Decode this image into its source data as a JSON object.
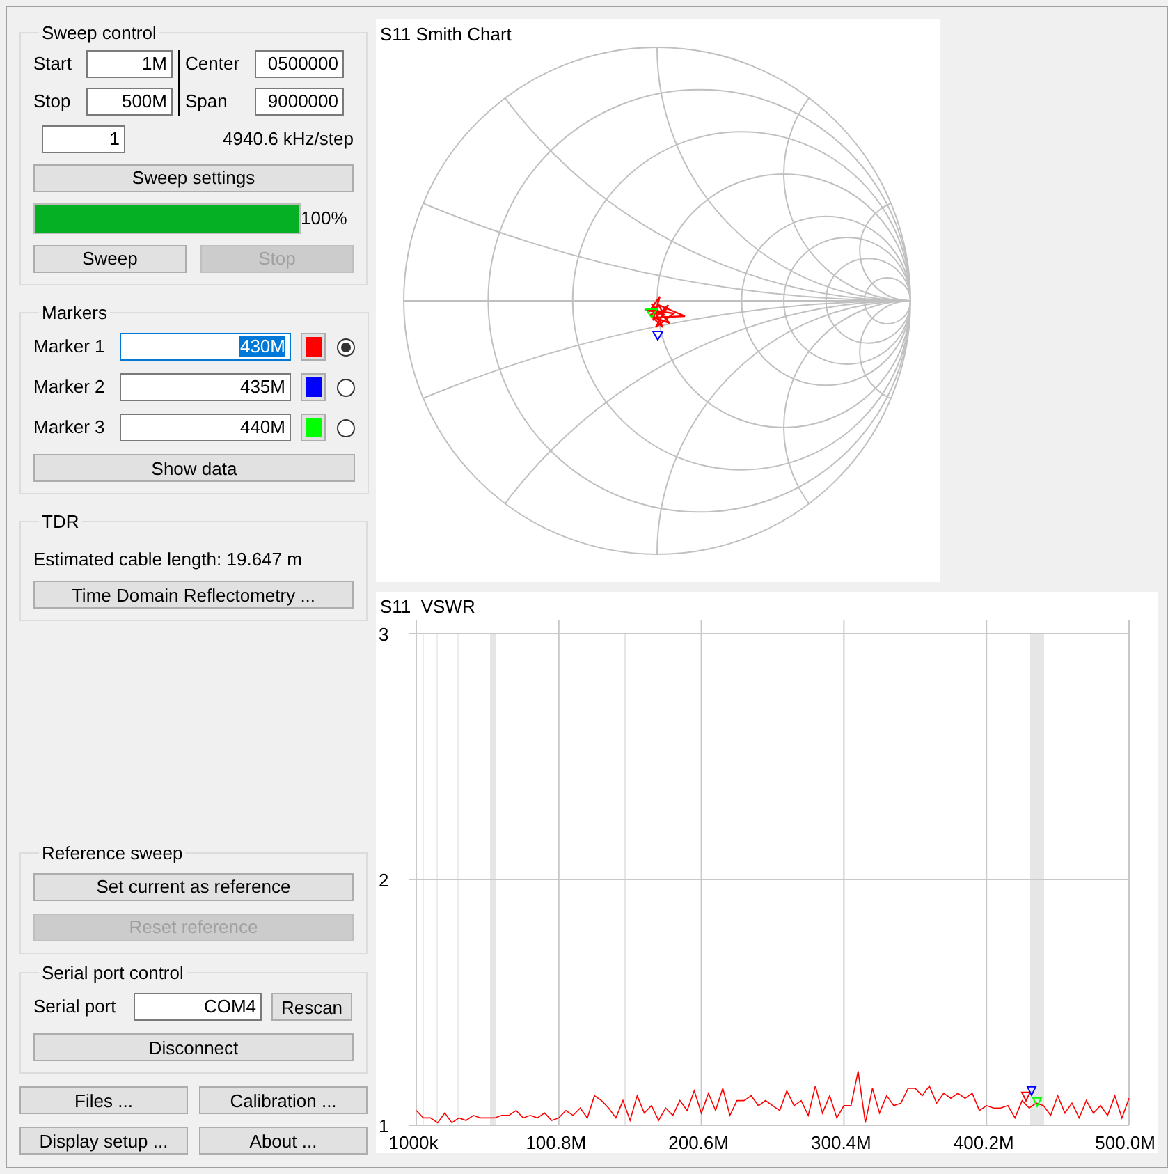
{
  "sweep_control": {
    "title": "Sweep control",
    "start": {
      "label": "Start",
      "value": "1M"
    },
    "stop": {
      "label": "Stop",
      "value": "500M"
    },
    "center": {
      "label": "Center",
      "value": "0500000"
    },
    "span": {
      "label": "Span",
      "value": "9000000"
    },
    "segments": {
      "value": "1"
    },
    "step": "4940.6 kHz/step",
    "settings_button": {
      "label": "Sweep settings",
      "disabled": false
    },
    "progress": {
      "level": 1.0,
      "reading": "100%"
    },
    "sweep_button": {
      "label": "Sweep",
      "disabled": false
    },
    "stop_button": {
      "label": "Stop",
      "disabled": true
    }
  },
  "markers": {
    "title": "Markers",
    "items": [
      {
        "label": "Marker 1",
        "value": "430M",
        "color": "#ff0000",
        "selected": true,
        "focused": true
      },
      {
        "label": "Marker 2",
        "value": "435M",
        "color": "#0000ff",
        "selected": false,
        "focused": false
      },
      {
        "label": "Marker 3",
        "value": "440M",
        "color": "#00ff00",
        "selected": false,
        "focused": false
      }
    ],
    "show_button": {
      "label": "Show data",
      "disabled": false
    }
  },
  "tdr": {
    "title": "TDR",
    "estimate": "Estimated cable length: 19.647 m",
    "button": {
      "label": "Time Domain Reflectometry ...",
      "disabled": false
    }
  },
  "reference_sweep": {
    "title": "Reference sweep",
    "set_button": {
      "label": "Set current as reference",
      "disabled": false
    },
    "reset_button": {
      "label": "Reset reference",
      "disabled": true
    }
  },
  "serial_port": {
    "title": "Serial port control",
    "label": "Serial port",
    "value": "COM4",
    "rescan_button": {
      "label": "Rescan",
      "disabled": false
    },
    "connect_button": {
      "label": "Disconnect",
      "disabled": false
    }
  },
  "bottom_buttons": [
    {
      "label": "Files ...",
      "disabled": false
    },
    {
      "label": "Calibration ...",
      "disabled": false
    },
    {
      "label": "Display setup ...",
      "disabled": false
    },
    {
      "label": "About ...",
      "disabled": false
    }
  ],
  "smith_chart": {
    "title": "S11 Smith Chart"
  },
  "vswr_chart": {
    "title": "S11  VSWR",
    "chart_data": {
      "type": "line",
      "grid": true,
      "xlim": [
        1000000,
        500000000
      ],
      "ylim": [
        1,
        3
      ],
      "x": [
        1000000,
        5990000,
        10980000,
        15970000,
        20960000,
        25950000,
        30940000,
        35930000,
        40920000,
        45910000,
        50900000,
        55890000,
        60880000,
        65870000,
        70860000,
        75850000,
        80840000,
        85830000,
        90820000,
        95810000,
        100800000,
        105790000,
        110780000,
        115770000,
        120760000,
        125750000,
        130740000,
        135730000,
        140720000,
        145710000,
        150700000,
        155690000,
        160680000,
        165670000,
        170660000,
        175650000,
        180640000,
        185630000,
        190620000,
        195610000,
        200600000,
        205590000,
        210580000,
        215570000,
        220560000,
        225550000,
        230540000,
        235530000,
        240520000,
        245510000,
        250500000,
        255490000,
        260480000,
        265470000,
        270460000,
        275450000,
        280440000,
        285430000,
        290420000,
        295410000,
        300400000,
        305390000,
        310380000,
        315370000,
        320360000,
        325350000,
        330340000,
        335330000,
        340320000,
        345310000,
        350300000,
        355290000,
        360280000,
        365270000,
        370260000,
        375250000,
        380240000,
        385230000,
        390220000,
        395210000,
        400200000,
        405190000,
        410180000,
        415170000,
        420160000,
        425150000,
        430140000,
        435130000,
        440120000,
        445110000,
        450100000,
        455090000,
        460080000,
        465070000,
        470060000,
        475050000,
        480040000,
        485030000,
        490020000,
        495010000,
        500000000
      ],
      "xticks": [
        {
          "value": 1000000,
          "label": "1000k"
        },
        {
          "value": 100800000,
          "label": "100.8M"
        },
        {
          "value": 200600000,
          "label": "200.6M"
        },
        {
          "value": 300400000,
          "label": "300.4M"
        },
        {
          "value": 400200000,
          "label": "400.2M"
        },
        {
          "value": 500000000,
          "label": "500.0M"
        }
      ],
      "yticks": [
        1,
        2,
        3
      ],
      "series": [
        {
          "color": "#ff0000",
          "values": [
            1.06,
            1.03,
            1.03,
            1.01,
            1.05,
            1.01,
            1.03,
            1.02,
            1.04,
            1.03,
            1.03,
            1.03,
            1.04,
            1.04,
            1.06,
            1.03,
            1.04,
            1.03,
            1.05,
            1.02,
            1.03,
            1.06,
            1.04,
            1.07,
            1.03,
            1.12,
            1.1,
            1.07,
            1.03,
            1.1,
            1.02,
            1.12,
            1.05,
            1.08,
            1.02,
            1.07,
            1.04,
            1.1,
            1.06,
            1.14,
            1.05,
            1.13,
            1.06,
            1.15,
            1.04,
            1.1,
            1.1,
            1.12,
            1.08,
            1.1,
            1.08,
            1.06,
            1.14,
            1.08,
            1.1,
            1.04,
            1.16,
            1.05,
            1.12,
            1.03,
            1.08,
            1.08,
            1.22,
            1.01,
            1.15,
            1.05,
            1.12,
            1.08,
            1.09,
            1.15,
            1.15,
            1.12,
            1.16,
            1.09,
            1.13,
            1.11,
            1.13,
            1.11,
            1.13,
            1.06,
            1.08,
            1.07,
            1.07,
            1.08,
            1.03,
            1.1,
            1.07,
            1.09,
            1.08,
            1.04,
            1.12,
            1.05,
            1.09,
            1.03,
            1.1,
            1.05,
            1.08,
            1.04,
            1.12,
            1.03,
            1.11
          ]
        }
      ]
    }
  }
}
